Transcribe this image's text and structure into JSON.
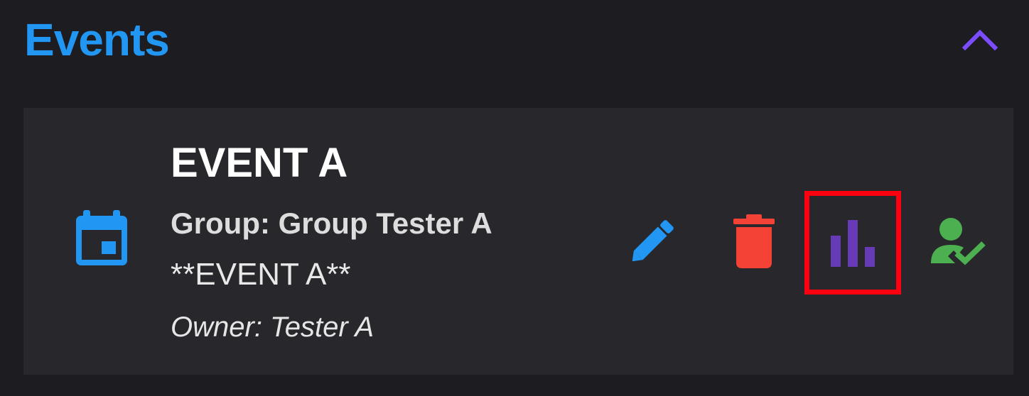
{
  "section": {
    "title": "Events",
    "collapse_icon": "chevron-up-icon",
    "accent_color": "#7c4dff"
  },
  "event": {
    "icon": "event-calendar-icon",
    "title": "EVENT A",
    "group": "Group: Group Tester A",
    "description": "**EVENT A**",
    "owner": "Owner: Tester A"
  },
  "actions": [
    {
      "name": "edit",
      "icon": "pencil-icon",
      "color": "#2196f3"
    },
    {
      "name": "delete",
      "icon": "trash-icon",
      "color": "#f44336"
    },
    {
      "name": "statistics",
      "icon": "bar-chart-icon",
      "color": "#673ab7",
      "highlighted": true,
      "highlight_color": "#ff0010"
    },
    {
      "name": "attendance",
      "icon": "person-check-icon",
      "color": "#4caf50"
    }
  ]
}
